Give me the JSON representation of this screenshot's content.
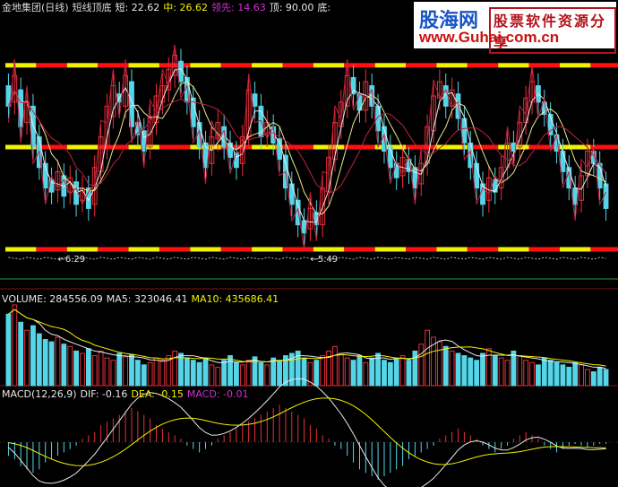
{
  "colors": {
    "up": "#e8303a",
    "down": "#55d6e8",
    "yellow": "#f2f200",
    "red": "#ff1010",
    "white": "#e8e8e8",
    "ma": "#f0e68c",
    "purple": "#d030d0",
    "pinkLine": "#c02040",
    "green": "#20a040"
  },
  "main": {
    "stock": "金地集团(日线)",
    "indicator": "短线顶底",
    "items": [
      {
        "label": "短:",
        "value": "22.62",
        "color": "#e8e8e8"
      },
      {
        "label": "中:",
        "value": "26.62",
        "color": "#f2f200"
      },
      {
        "label": "领先:",
        "value": "14.63",
        "color": "#d030d0"
      },
      {
        "label": "顶:",
        "value": "90.00",
        "color": "#e8e8e8"
      },
      {
        "label": "底:",
        "value": "",
        "color": "#e8e8e8"
      }
    ],
    "low_labels": [
      "6.29",
      "5.49"
    ]
  },
  "volume": {
    "items": [
      {
        "label": "VOLUME:",
        "value": "284556.09",
        "color": "#e8e8e8"
      },
      {
        "label": "MA5:",
        "value": "323046.41",
        "color": "#e8e8e8"
      },
      {
        "label": "MA10:",
        "value": "435686.41",
        "color": "#f2f200"
      }
    ]
  },
  "macd": {
    "items": [
      {
        "label": "MACD(12,26,9)",
        "value": "",
        "color": "#e8e8e8"
      },
      {
        "label": "DIF:",
        "value": "-0.16",
        "color": "#e8e8e8"
      },
      {
        "label": "DEA:",
        "value": "-0.15",
        "color": "#f2f200"
      },
      {
        "label": "MACD:",
        "value": "-0.01",
        "color": "#d030d0"
      }
    ]
  },
  "watermark": {
    "logo": "股海网",
    "tagline": "股票软件资源分享",
    "url": "www.Guhai.com.cn"
  },
  "chart_data": {
    "type": "indicator",
    "ylim": [
      0,
      100
    ],
    "levels": [
      90,
      50,
      0
    ],
    "candles": [
      {
        "o": 80,
        "c": 70
      },
      {
        "o": 72,
        "c": 85
      },
      {
        "o": 78,
        "c": 60
      },
      {
        "o": 62,
        "c": 72
      },
      {
        "o": 70,
        "c": 50
      },
      {
        "o": 55,
        "c": 40
      },
      {
        "o": 42,
        "c": 30
      },
      {
        "o": 34,
        "c": 28
      },
      {
        "o": 29,
        "c": 38
      },
      {
        "o": 36,
        "c": 26
      },
      {
        "o": 28,
        "c": 35
      },
      {
        "o": 33,
        "c": 22
      },
      {
        "o": 24,
        "c": 30
      },
      {
        "o": 30,
        "c": 20
      },
      {
        "o": 22,
        "c": 40
      },
      {
        "o": 38,
        "c": 55
      },
      {
        "o": 50,
        "c": 70
      },
      {
        "o": 65,
        "c": 80
      },
      {
        "o": 76,
        "c": 72
      },
      {
        "o": 70,
        "c": 85
      },
      {
        "o": 82,
        "c": 60
      },
      {
        "o": 62,
        "c": 56
      },
      {
        "o": 58,
        "c": 48
      },
      {
        "o": 50,
        "c": 65
      },
      {
        "o": 62,
        "c": 75
      },
      {
        "o": 72,
        "c": 80
      },
      {
        "o": 78,
        "c": 88
      },
      {
        "o": 85,
        "c": 95
      },
      {
        "o": 92,
        "c": 82
      },
      {
        "o": 84,
        "c": 72
      },
      {
        "o": 74,
        "c": 60
      },
      {
        "o": 62,
        "c": 50
      },
      {
        "o": 52,
        "c": 40
      },
      {
        "o": 42,
        "c": 55
      },
      {
        "o": 54,
        "c": 62
      },
      {
        "o": 60,
        "c": 50
      },
      {
        "o": 52,
        "c": 45
      },
      {
        "o": 47,
        "c": 40
      },
      {
        "o": 42,
        "c": 55
      },
      {
        "o": 55,
        "c": 78
      },
      {
        "o": 76,
        "c": 70
      },
      {
        "o": 70,
        "c": 55
      },
      {
        "o": 56,
        "c": 62
      },
      {
        "o": 60,
        "c": 52
      },
      {
        "o": 54,
        "c": 44
      },
      {
        "o": 46,
        "c": 30
      },
      {
        "o": 32,
        "c": 22
      },
      {
        "o": 24,
        "c": 12
      },
      {
        "o": 14,
        "c": 8
      },
      {
        "o": 10,
        "c": 20
      },
      {
        "o": 18,
        "c": 12
      },
      {
        "o": 12,
        "c": 30
      },
      {
        "o": 28,
        "c": 45
      },
      {
        "o": 44,
        "c": 62
      },
      {
        "o": 60,
        "c": 72
      },
      {
        "o": 70,
        "c": 85
      },
      {
        "o": 84,
        "c": 76
      },
      {
        "o": 76,
        "c": 68
      },
      {
        "o": 68,
        "c": 82
      },
      {
        "o": 80,
        "c": 70
      },
      {
        "o": 70,
        "c": 58
      },
      {
        "o": 60,
        "c": 48
      },
      {
        "o": 50,
        "c": 40
      },
      {
        "o": 42,
        "c": 35
      },
      {
        "o": 36,
        "c": 45
      },
      {
        "o": 44,
        "c": 38
      },
      {
        "o": 40,
        "c": 30
      },
      {
        "o": 32,
        "c": 42
      },
      {
        "o": 42,
        "c": 60
      },
      {
        "o": 58,
        "c": 75
      },
      {
        "o": 74,
        "c": 82
      },
      {
        "o": 80,
        "c": 70
      },
      {
        "o": 70,
        "c": 78
      },
      {
        "o": 76,
        "c": 64
      },
      {
        "o": 64,
        "c": 52
      },
      {
        "o": 52,
        "c": 40
      },
      {
        "o": 42,
        "c": 30
      },
      {
        "o": 32,
        "c": 22
      },
      {
        "o": 24,
        "c": 35
      },
      {
        "o": 34,
        "c": 28
      },
      {
        "o": 30,
        "c": 40
      },
      {
        "o": 40,
        "c": 52
      },
      {
        "o": 52,
        "c": 48
      },
      {
        "o": 50,
        "c": 62
      },
      {
        "o": 62,
        "c": 74
      },
      {
        "o": 72,
        "c": 82
      },
      {
        "o": 80,
        "c": 72
      },
      {
        "o": 72,
        "c": 66
      },
      {
        "o": 66,
        "c": 56
      },
      {
        "o": 56,
        "c": 48
      },
      {
        "o": 48,
        "c": 38
      },
      {
        "o": 40,
        "c": 30
      },
      {
        "o": 30,
        "c": 22
      },
      {
        "o": 24,
        "c": 36
      },
      {
        "o": 36,
        "c": 48
      },
      {
        "o": 48,
        "c": 42
      },
      {
        "o": 42,
        "c": 30
      },
      {
        "o": 32,
        "c": 20
      }
    ],
    "volume": [
      62,
      70,
      55,
      48,
      52,
      45,
      40,
      38,
      42,
      36,
      34,
      30,
      28,
      32,
      26,
      30,
      24,
      22,
      28,
      25,
      27,
      22,
      18,
      20,
      24,
      22,
      26,
      30,
      28,
      24,
      22,
      20,
      24,
      18,
      16,
      22,
      26,
      20,
      18,
      22,
      25,
      20,
      18,
      24,
      22,
      26,
      28,
      30,
      24,
      20,
      22,
      26,
      30,
      34,
      28,
      24,
      22,
      26,
      20,
      24,
      28,
      22,
      20,
      24,
      26,
      22,
      30,
      36,
      48,
      42,
      38,
      34,
      30,
      28,
      26,
      24,
      22,
      28,
      32,
      26,
      24,
      22,
      30,
      26,
      22,
      20,
      18,
      24,
      22,
      20,
      18,
      16,
      20,
      18,
      14,
      12,
      16,
      14
    ],
    "macd_hist": [
      -8,
      -10,
      -14,
      -16,
      -18,
      -16,
      -12,
      -10,
      -8,
      -6,
      -4,
      -2,
      2,
      4,
      6,
      10,
      12,
      14,
      16,
      18,
      20,
      18,
      16,
      14,
      10,
      8,
      6,
      4,
      2,
      -2,
      -4,
      -6,
      -4,
      -2,
      2,
      4,
      6,
      8,
      10,
      12,
      14,
      16,
      18,
      20,
      22,
      20,
      18,
      16,
      14,
      10,
      8,
      4,
      2,
      -2,
      -4,
      -8,
      -12,
      -16,
      -18,
      -20,
      -22,
      -20,
      -18,
      -16,
      -14,
      -10,
      -8,
      -6,
      -4,
      -2,
      2,
      4,
      6,
      8,
      6,
      4,
      2,
      -2,
      -4,
      -6,
      -4,
      -2,
      2,
      4,
      6,
      4,
      2,
      -2,
      -4,
      -6,
      -4,
      -2,
      -1,
      -2,
      -3,
      -2,
      -1,
      -1
    ]
  }
}
